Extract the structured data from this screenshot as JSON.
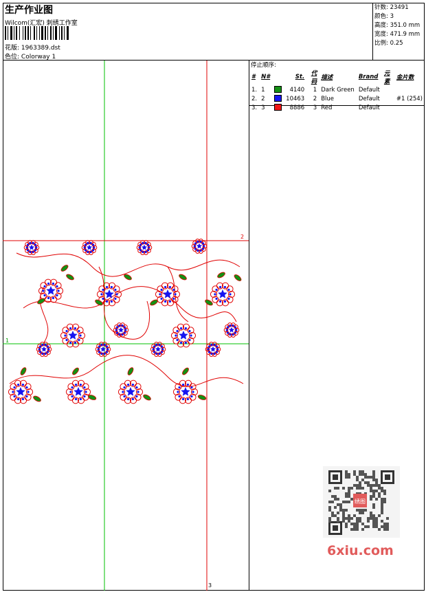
{
  "header": {
    "title": "生产作业图",
    "company": "Wilcom(汇宏) 刺绣工作室",
    "design_label": "花版:",
    "design_value": "1963389.dst",
    "colorway_label": "色位:",
    "colorway_value": "Colorway 1"
  },
  "stats": [
    {
      "label": "针数:",
      "value": "23491"
    },
    {
      "label": "颜色:",
      "value": "3"
    },
    {
      "label": "高度:",
      "value": "351.0 mm"
    },
    {
      "label": "宽度:",
      "value": "471.9 mm"
    },
    {
      "label": "比例:",
      "value": "0.25"
    }
  ],
  "stop_sequence": {
    "title": "停止顺序:",
    "columns": [
      "#",
      "N#",
      "St.",
      "代码",
      "描述",
      "Brand",
      "元素",
      "金片数"
    ],
    "rows": [
      {
        "num": "1.",
        "n": "1",
        "color": "#149014",
        "stitches": "4140",
        "code": "1",
        "desc": "Dark Green",
        "brand": "Default",
        "element": "",
        "sequins": ""
      },
      {
        "num": "2.",
        "n": "2",
        "color": "#1515f0",
        "stitches": "10463",
        "code": "2",
        "desc": "Blue",
        "brand": "Default",
        "element": "",
        "sequins": "#1 (254)"
      },
      {
        "num": "3.",
        "n": "3",
        "color": "#f01515",
        "stitches": "8886",
        "code": "3",
        "desc": "Red",
        "brand": "Default",
        "element": "",
        "sequins": ""
      }
    ]
  },
  "guides": {
    "marker_1": "1",
    "marker_2": "2",
    "marker_3": "3"
  },
  "colors": {
    "guide_green": "#00c000",
    "guide_red": "#e00000",
    "watermark": "#e15b5b"
  },
  "watermark": {
    "site": "6xiu.com",
    "badge": "绣图"
  }
}
